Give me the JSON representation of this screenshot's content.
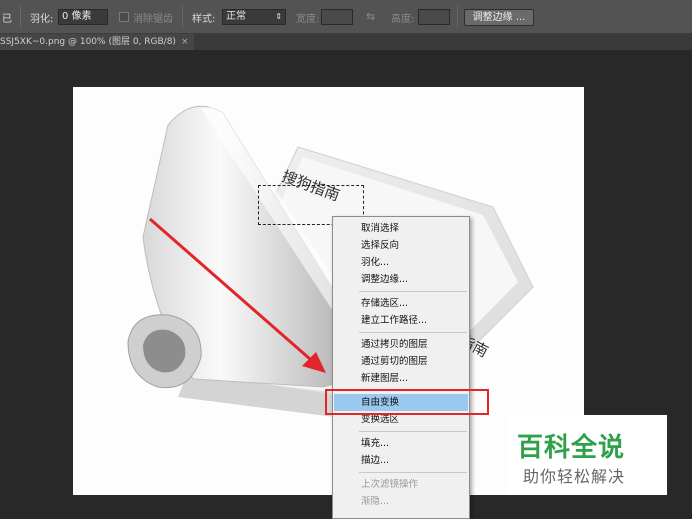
{
  "options_bar": {
    "partial_label": "已",
    "feather_label": "羽化:",
    "feather_value": "0 像素",
    "antialias_label": "消除锯齿",
    "style_label": "样式:",
    "style_value": "正常",
    "width_label": "宽度:",
    "height_label": "高度:",
    "refine_edge_label": "调整边缘 ..."
  },
  "document_tab": {
    "title": "SSJ5XK~0.png @ 100% (图层 0, RGB/8)",
    "close": "×"
  },
  "canvas_text": {
    "title_on_page": "搜狗指南",
    "partial_text": "指南"
  },
  "context_menu": {
    "items": [
      {
        "label": "取消选择",
        "enabled": true
      },
      {
        "label": "选择反向",
        "enabled": true
      },
      {
        "label": "羽化...",
        "enabled": true
      },
      {
        "label": "调整边缘...",
        "enabled": true
      },
      {
        "label": "存储选区...",
        "enabled": true
      },
      {
        "label": "建立工作路径...",
        "enabled": true
      },
      {
        "label": "通过拷贝的图层",
        "enabled": true
      },
      {
        "label": "通过剪切的图层",
        "enabled": true
      },
      {
        "label": "新建图层...",
        "enabled": true
      },
      {
        "label": "自由变换",
        "enabled": true,
        "highlighted": true
      },
      {
        "label": "变换选区",
        "enabled": true
      },
      {
        "label": "填充...",
        "enabled": true
      },
      {
        "label": "描边...",
        "enabled": true
      },
      {
        "label": "上次滤镜操作",
        "enabled": false
      },
      {
        "label": "渐隐...",
        "enabled": false
      }
    ]
  },
  "annotation": {
    "arrow_color": "#e0262a",
    "box_color": "#e0262a"
  },
  "watermark": {
    "title": "百科全说",
    "subtitle": "助你轻松解决",
    "title_color": "#2fa14b"
  }
}
